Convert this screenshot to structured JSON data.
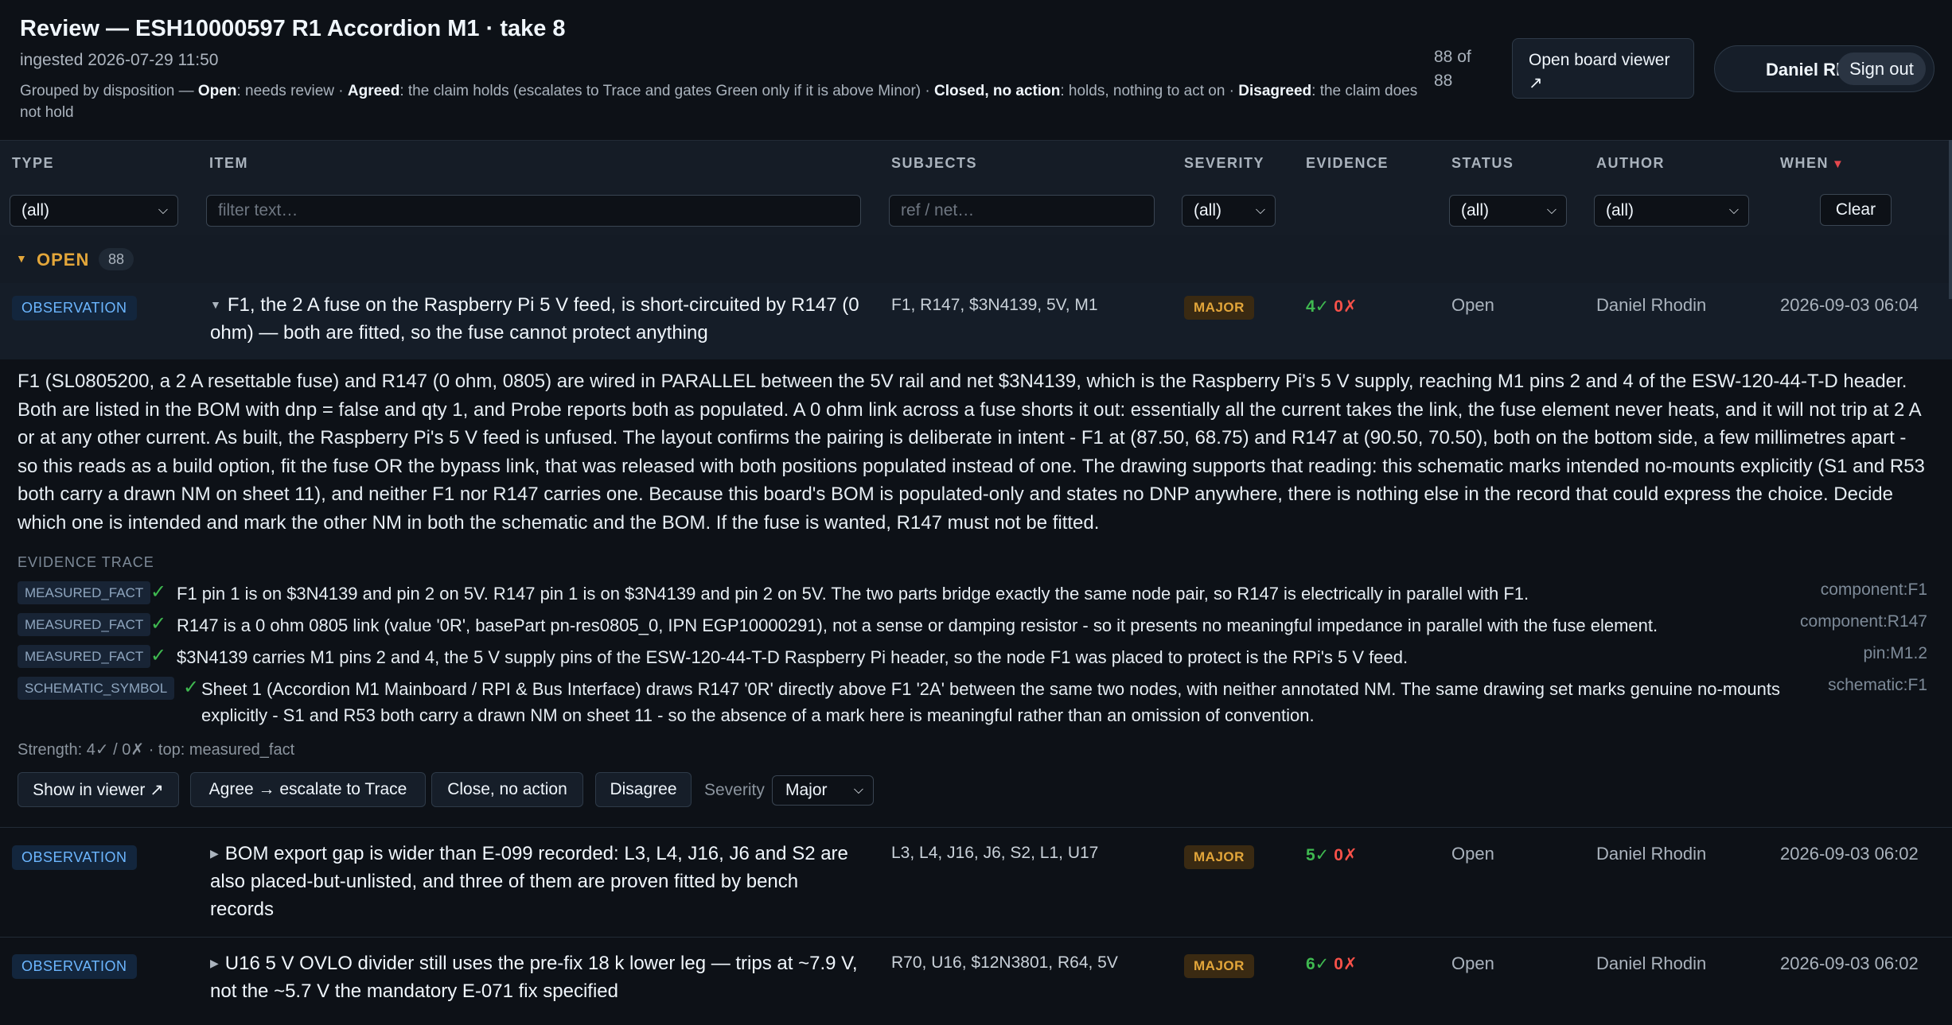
{
  "header": {
    "title": "Review — ESH10000597 R1 Accordion M1 · take 8",
    "ingested": "ingested 2026-07-29 11:50",
    "legend": {
      "intro": "Grouped by disposition — ",
      "open_label": "Open",
      "open_text": ": needs review · ",
      "agreed_label": "Agreed",
      "agreed_text": ": the claim holds (escalates to Trace and gates Green only if it is above Minor) · ",
      "closed_label": "Closed, no action",
      "closed_text": ": holds, nothing to act on · ",
      "disagreed_label": "Disagreed",
      "disagreed_text": ": the claim does not hold"
    },
    "count": "88 of 88",
    "open_viewer": "Open board viewer ↗",
    "user_name": "Daniel Rho...",
    "sign_out": "Sign out"
  },
  "columns": {
    "type": "TYPE",
    "item": "ITEM",
    "subjects": "SUBJECTS",
    "severity": "SEVERITY",
    "evidence": "EVIDENCE",
    "status": "STATUS",
    "author": "AUTHOR",
    "when": "WHEN"
  },
  "filters": {
    "type": "(all)",
    "item_placeholder": "filter text…",
    "subjects_placeholder": "ref / net…",
    "severity": "(all)",
    "status": "(all)",
    "author": "(all)",
    "clear": "Clear"
  },
  "group": {
    "name": "OPEN",
    "count": "88"
  },
  "rows": [
    {
      "type": "OBSERVATION",
      "item": "F1, the 2 A fuse on the Raspberry Pi 5 V feed, is short-circuited by R147 (0 ohm) — both are fitted, so the fuse cannot protect anything",
      "subjects": "F1, R147, $3N4139, 5V, M1",
      "severity": "MAJOR",
      "ev_ok": "4✓",
      "ev_bad": "0✗",
      "status": "Open",
      "author": "Daniel Rhodin",
      "when": "2026-09-03 06:04"
    },
    {
      "type": "OBSERVATION",
      "item": "BOM export gap is wider than E-099 recorded: L3, L4, J16, J6 and S2 are also placed-but-unlisted, and three of them are proven fitted by bench records",
      "subjects": "L3, L4, J16, J6, S2, L1, U17",
      "severity": "MAJOR",
      "ev_ok": "5✓",
      "ev_bad": "0✗",
      "status": "Open",
      "author": "Daniel Rhodin",
      "when": "2026-09-03 06:02"
    },
    {
      "type": "OBSERVATION",
      "item": "U16 5 V OVLO divider still uses the pre-fix 18 k lower leg — trips at ~7.9 V, not the ~5.7 V the mandatory E-071 fix specified",
      "subjects": "R70, U16, $12N3801, R64, 5V",
      "severity": "MAJOR",
      "ev_ok": "6✓",
      "ev_bad": "0✗",
      "status": "Open",
      "author": "Daniel Rhodin",
      "when": "2026-09-03 06:02"
    }
  ],
  "detail": {
    "description": "F1 (SL0805200, a 2 A resettable fuse) and R147 (0 ohm, 0805) are wired in PARALLEL between the 5V rail and net $3N4139, which is the Raspberry Pi's 5 V supply, reaching M1 pins 2 and 4 of the ESW-120-44-T-D header. Both are listed in the BOM with dnp = false and qty 1, and Probe reports both as populated. A 0 ohm link across a fuse shorts it out: essentially all the current takes the link, the fuse element never heats, and it will not trip at 2 A or at any other current. As built, the Raspberry Pi's 5 V feed is unfused. The layout confirms the pairing is deliberate in intent - F1 at (87.50, 68.75) and R147 at (90.50, 70.50), both on the bottom side, a few millimetres apart - so this reads as a build option, fit the fuse OR the bypass link, that was released with both positions populated instead of one. The drawing supports that reading: this schematic marks intended no-mounts explicitly (S1 and R53 both carry a drawn NM on sheet 11), and neither F1 nor R147 carries one. Because this board's BOM is populated-only and states no DNP anywhere, there is nothing else in the record that could express the choice. Decide which one is intended and mark the other NM in both the schematic and the BOM. If the fuse is wanted, R147 must not be fitted.",
    "trace_heading": "EVIDENCE TRACE",
    "evidence": [
      {
        "type": "MEASURED_FACT",
        "check": "✓",
        "text": "F1 pin 1 is on $3N4139 and pin 2 on 5V. R147 pin 1 is on $3N4139 and pin 2 on 5V. The two parts bridge exactly the same node pair, so R147 is electrically in parallel with F1.",
        "ref": "component:F1"
      },
      {
        "type": "MEASURED_FACT",
        "check": "✓",
        "text": "R147 is a 0 ohm 0805 link (value '0R', basePart pn-res0805_0, IPN EGP10000291), not a sense or damping resistor - so it presents no meaningful impedance in parallel with the fuse element.",
        "ref": "component:R147"
      },
      {
        "type": "MEASURED_FACT",
        "check": "✓",
        "text": "$3N4139 carries M1 pins 2 and 4, the 5 V supply pins of the ESW-120-44-T-D Raspberry Pi header, so the node F1 was placed to protect is the RPi's 5 V feed.",
        "ref": "pin:M1.2"
      },
      {
        "type": "SCHEMATIC_SYMBOL",
        "check": "✓",
        "text": "Sheet 1 (Accordion M1 Mainboard / RPI & Bus Interface) draws R147 '0R' directly above F1 '2A' between the same two nodes, with neither annotated NM. The same drawing set marks genuine no-mounts explicitly - S1 and R53 both carry a drawn NM on sheet 11 - so the absence of a mark here is meaningful rather than an omission of convention.",
        "ref": "schematic:F1"
      }
    ],
    "strength": "Strength: 4✓ / 0✗ · top: measured_fact",
    "actions": {
      "show_viewer": "Show in viewer ↗",
      "agree": "Agree → escalate to Trace",
      "close": "Close, no action",
      "disagree": "Disagree",
      "severity_label": "Severity",
      "severity_value": "Major"
    }
  }
}
